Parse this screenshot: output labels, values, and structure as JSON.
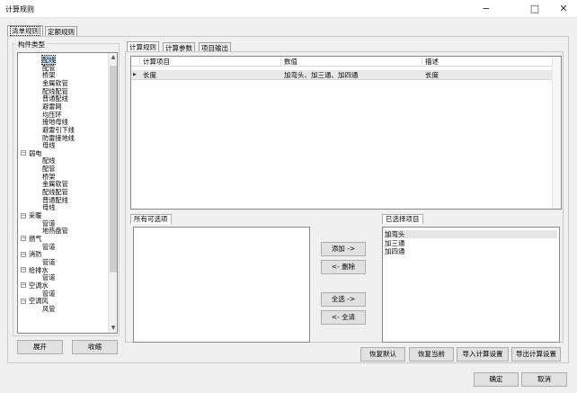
{
  "window": {
    "title": "计算规则",
    "min_glyph": "−",
    "max_glyph": "□",
    "close_glyph": "✕"
  },
  "top_tabs": [
    "清单规则",
    "定额规则"
  ],
  "left_panel": {
    "group_title": "构件类型",
    "tree": [
      {
        "label": "配线",
        "level": 2,
        "selected": true
      },
      {
        "label": "配管",
        "level": 2
      },
      {
        "label": "桥架",
        "level": 2
      },
      {
        "label": "金属软管",
        "level": 2
      },
      {
        "label": "配线配管",
        "level": 2
      },
      {
        "label": "普通配线",
        "level": 2
      },
      {
        "label": "避雷网",
        "level": 2
      },
      {
        "label": "均压环",
        "level": 2
      },
      {
        "label": "接地母线",
        "level": 2
      },
      {
        "label": "避雷引下线",
        "level": 2
      },
      {
        "label": "防雷接地线",
        "level": 2
      },
      {
        "label": "母线",
        "level": 2
      },
      {
        "label": "弱电",
        "level": 1,
        "toggle": "−"
      },
      {
        "label": "配线",
        "level": 2
      },
      {
        "label": "配管",
        "level": 2
      },
      {
        "label": "桥架",
        "level": 2
      },
      {
        "label": "金属软管",
        "level": 2
      },
      {
        "label": "配线配管",
        "level": 2
      },
      {
        "label": "普通配线",
        "level": 2
      },
      {
        "label": "母线",
        "level": 2
      },
      {
        "label": "采暖",
        "level": 1,
        "toggle": "−"
      },
      {
        "label": "管道",
        "level": 2
      },
      {
        "label": "地热盘管",
        "level": 2
      },
      {
        "label": "燃气",
        "level": 1,
        "toggle": "−"
      },
      {
        "label": "管道",
        "level": 2
      },
      {
        "label": "消防",
        "level": 1,
        "toggle": "−"
      },
      {
        "label": "管道",
        "level": 2
      },
      {
        "label": "给排水",
        "level": 1,
        "toggle": "−"
      },
      {
        "label": "管道",
        "level": 2
      },
      {
        "label": "空调水",
        "level": 1,
        "toggle": "−"
      },
      {
        "label": "管道",
        "level": 2
      },
      {
        "label": "空调风",
        "level": 1,
        "toggle": "−"
      },
      {
        "label": "风管",
        "level": 2
      }
    ],
    "expand_button": "展开",
    "collapse_button": "收缩"
  },
  "right_tabs": [
    "计算规则",
    "计算参数",
    "项目输出"
  ],
  "grid": {
    "columns": [
      "计算项目",
      "数值",
      "描述"
    ],
    "rows": [
      {
        "item": "长度",
        "value": "加弯头、加三通、加四通",
        "desc": "长度"
      }
    ]
  },
  "available": {
    "title": "所有可选项",
    "items": []
  },
  "selected": {
    "title": "已选择项目",
    "items": [
      "加弯头",
      "加三通",
      "加四通"
    ]
  },
  "move_buttons": {
    "add": "添加 ->",
    "remove": "<- 删除",
    "select_all": "全选 ->",
    "clear_all": "<- 全清"
  },
  "action_buttons": {
    "restore_default": "恢复默认",
    "restore_current": "恢复当前",
    "import": "导入计算设置",
    "export": "导出计算设置"
  },
  "dialog_buttons": {
    "ok": "确定",
    "cancel": "取消"
  }
}
